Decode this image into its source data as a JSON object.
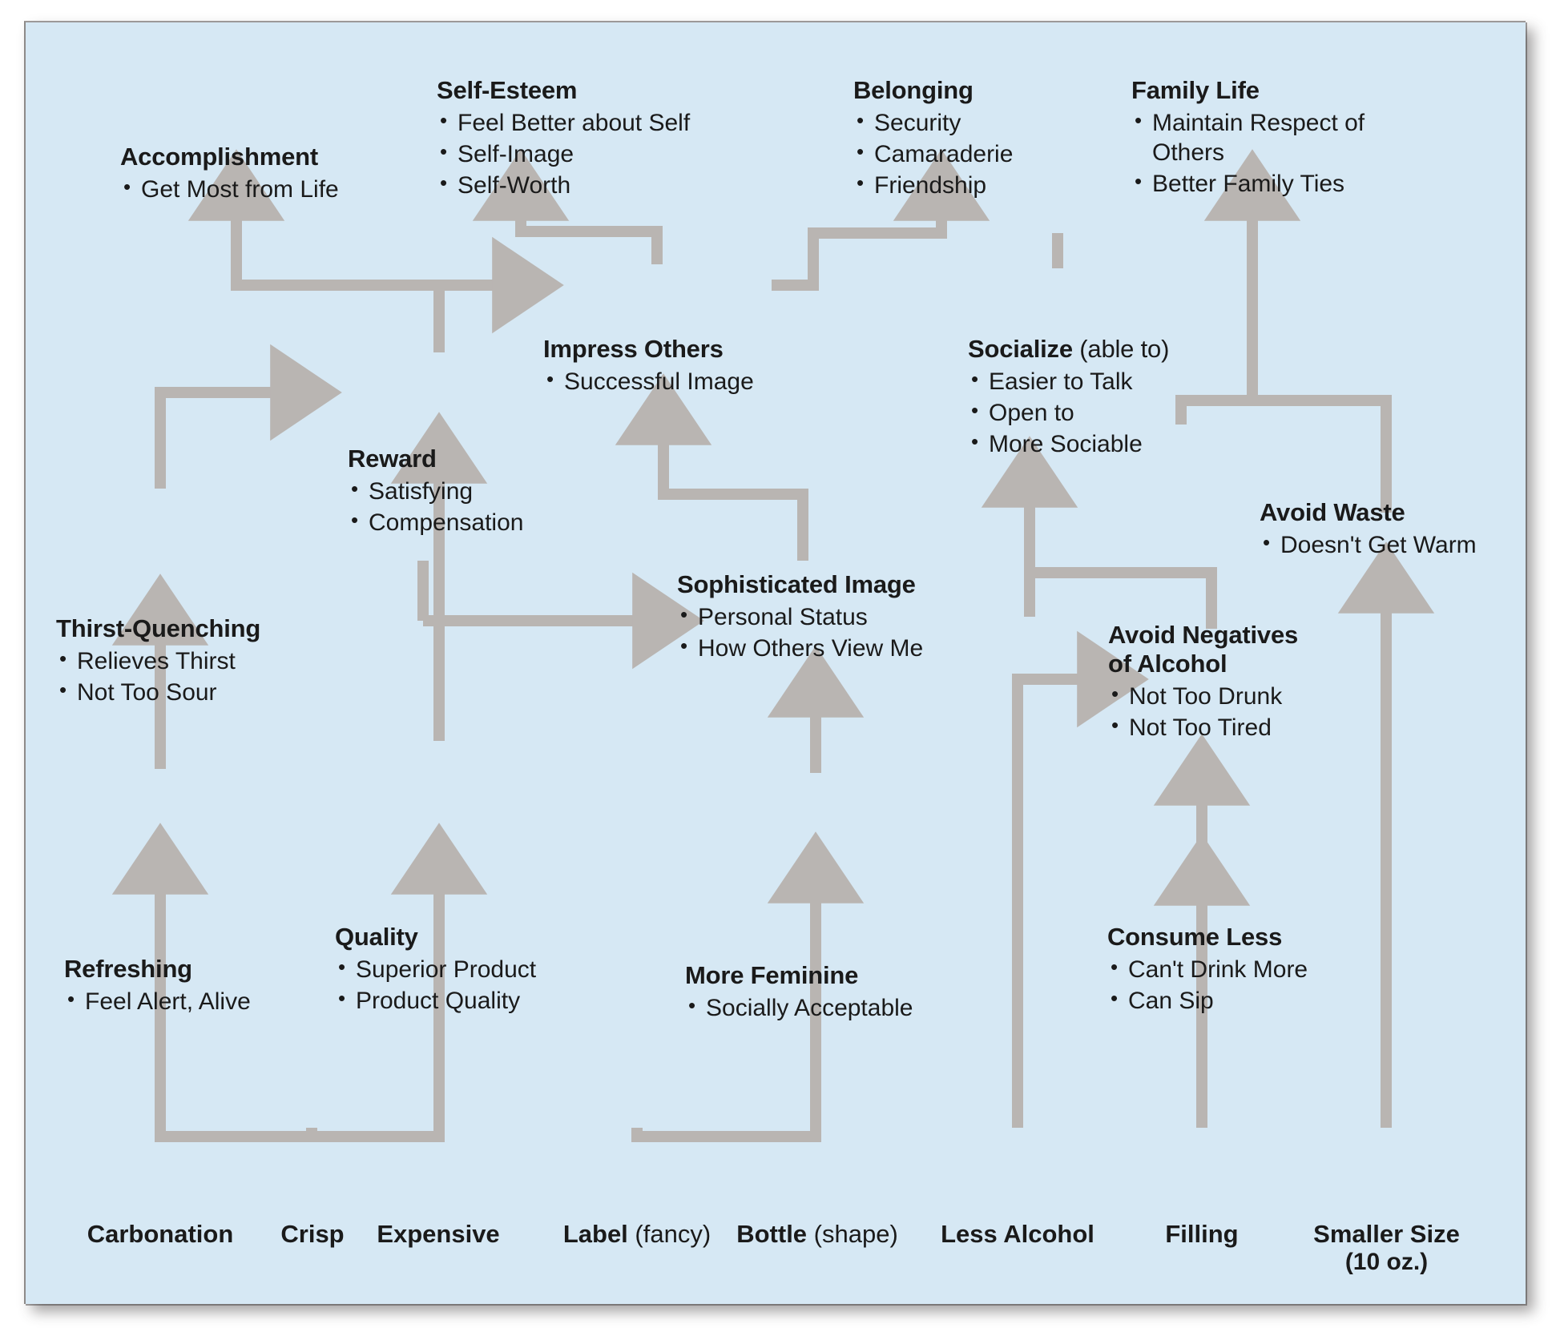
{
  "diagram": {
    "title": "Means-End Chain Ladder",
    "colors": {
      "panel_background": "#d6e8f4",
      "arrow": "#b9b5b2",
      "text": "#1a1a1a"
    },
    "nodes": [
      {
        "id": "accomplishment",
        "heading": "Accomplishment",
        "bullets": [
          "Get Most from Life"
        ]
      },
      {
        "id": "self-esteem",
        "heading": "Self-Esteem",
        "bullets": [
          "Feel Better about Self",
          "Self-Image",
          "Self-Worth"
        ]
      },
      {
        "id": "belonging",
        "heading": "Belonging",
        "bullets": [
          "Security",
          "Camaraderie",
          "Friendship"
        ]
      },
      {
        "id": "family-life",
        "heading": "Family Life",
        "bullets": [
          "Maintain Respect of Others",
          "Better Family Ties"
        ]
      },
      {
        "id": "impress-others",
        "heading": "Impress Others",
        "bullets": [
          "Successful Image"
        ]
      },
      {
        "id": "socialize",
        "heading": "Socialize",
        "heading_sub": " (able to)",
        "bullets": [
          "Easier to Talk",
          "Open to",
          "More Sociable"
        ]
      },
      {
        "id": "reward",
        "heading": "Reward",
        "bullets": [
          "Satisfying",
          "Compensation"
        ]
      },
      {
        "id": "avoid-waste",
        "heading": "Avoid Waste",
        "bullets": [
          "Doesn't Get Warm"
        ]
      },
      {
        "id": "thirst-quenching",
        "heading": "Thirst-Quenching",
        "bullets": [
          "Relieves Thirst",
          "Not Too Sour"
        ]
      },
      {
        "id": "sophisticated-image",
        "heading": "Sophisticated Image",
        "bullets": [
          "Personal Status",
          "How Others View Me"
        ]
      },
      {
        "id": "avoid-negatives",
        "heading": "Avoid Negatives",
        "heading_line2": "of Alcohol",
        "bullets": [
          "Not Too Drunk",
          "Not Too Tired"
        ]
      },
      {
        "id": "refreshing",
        "heading": "Refreshing",
        "bullets": [
          "Feel Alert, Alive"
        ]
      },
      {
        "id": "quality",
        "heading": "Quality",
        "bullets": [
          "Superior Product",
          "Product Quality"
        ]
      },
      {
        "id": "more-feminine",
        "heading": "More Feminine",
        "bullets": [
          "Socially Acceptable"
        ]
      },
      {
        "id": "consume-less",
        "heading": "Consume Less",
        "bullets": [
          "Can't Drink More",
          "Can Sip"
        ]
      }
    ],
    "base_attributes": [
      {
        "id": "carbonation",
        "label": "Carbonation",
        "sub": ""
      },
      {
        "id": "crisp",
        "label": "Crisp",
        "sub": ""
      },
      {
        "id": "expensive",
        "label": "Expensive",
        "sub": ""
      },
      {
        "id": "label-fancy",
        "label": "Label",
        "sub": " (fancy)"
      },
      {
        "id": "bottle-shape",
        "label": "Bottle",
        "sub": " (shape)"
      },
      {
        "id": "less-alcohol",
        "label": "Less Alcohol",
        "sub": ""
      },
      {
        "id": "filling",
        "label": "Filling",
        "sub": ""
      },
      {
        "id": "smaller-size",
        "label": "Smaller Size",
        "sub": "",
        "line2": "(10 oz.)"
      }
    ]
  }
}
